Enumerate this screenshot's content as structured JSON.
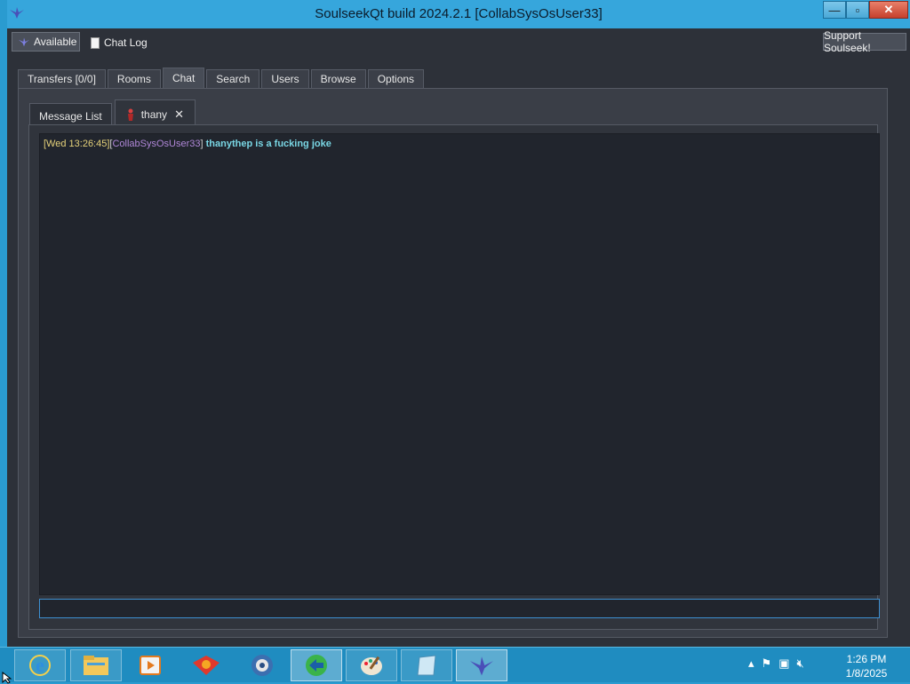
{
  "window": {
    "title": "SoulseekQt build 2024.2.1 [CollabSysOsUser33]",
    "controls": {
      "minimize": "—",
      "maximize": "▫",
      "close": "✕"
    }
  },
  "toolbar": {
    "available_label": "Available",
    "chat_log_label": "Chat Log",
    "support_label": "Support Soulseek!"
  },
  "main_tabs": [
    {
      "label": "Transfers [0/0]",
      "active": false
    },
    {
      "label": "Rooms",
      "active": false
    },
    {
      "label": "Chat",
      "active": true
    },
    {
      "label": "Search",
      "active": false
    },
    {
      "label": "Users",
      "active": false
    },
    {
      "label": "Browse",
      "active": false
    },
    {
      "label": "Options",
      "active": false
    }
  ],
  "chat_tabs": [
    {
      "label": "Message List",
      "active": false
    },
    {
      "label": "thany",
      "active": true,
      "close_icon": "close-icon"
    }
  ],
  "chat": {
    "messages": [
      {
        "timestamp": "[Wed 13:26:45]",
        "user": "CollabSysOsUser33",
        "text": "thanythep is a fucking joke"
      }
    ],
    "input_value": ""
  },
  "taskbar": {
    "apps": [
      "internet-explorer-icon",
      "file-explorer-icon",
      "media-player-icon",
      "firefox-dev-icon",
      "fast-browser-icon",
      "download-manager-icon",
      "paint-icon",
      "notepad-icon",
      "soulseek-icon"
    ],
    "clock_time": "1:26 PM",
    "clock_date": "1/8/2025"
  },
  "colors": {
    "timestamp": "#e6d27a",
    "username": "#b087d8",
    "message": "#79d6e4",
    "window_frame": "#36a6dc",
    "panel_bg": "#2d3139"
  }
}
